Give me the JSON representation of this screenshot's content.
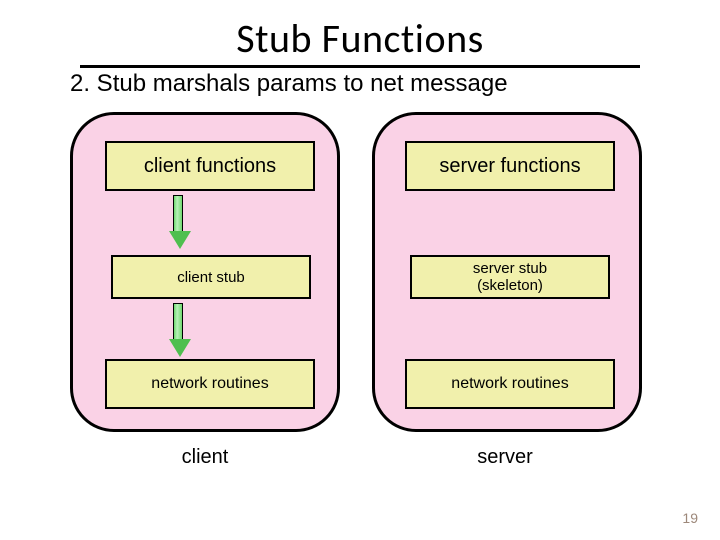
{
  "title": "Stub Functions",
  "subtitle": "2. Stub marshals params to net message",
  "client": {
    "caption": "client",
    "box_functions": "client functions",
    "box_stub": "client stub",
    "box_network": "network routines"
  },
  "server": {
    "caption": "server",
    "box_functions": "server functions",
    "box_stub_line1": "server stub",
    "box_stub_line2": "(skeleton)",
    "box_network": "network routines"
  },
  "page_number": "19"
}
